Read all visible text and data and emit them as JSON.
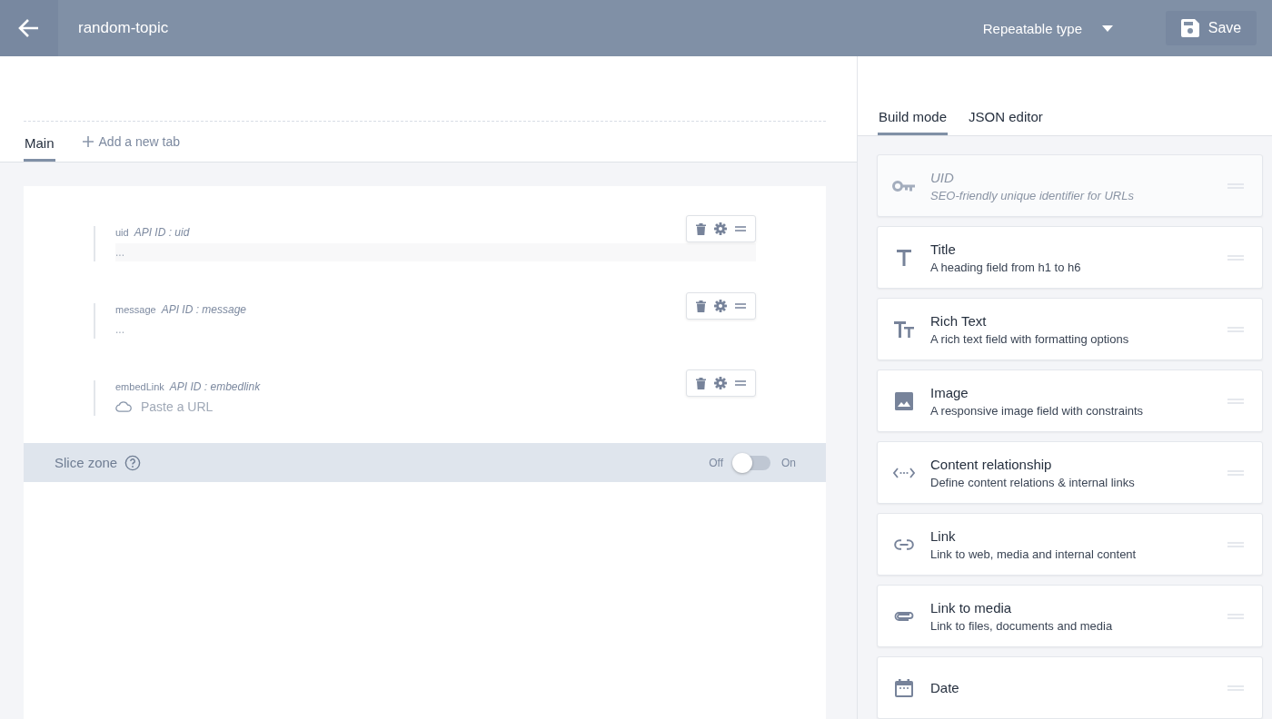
{
  "header": {
    "title": "random-topic",
    "type_select": "Repeatable type",
    "save": "Save"
  },
  "tabs": [
    {
      "label": "Main",
      "selected": true
    }
  ],
  "add_tab": "Add a new tab",
  "fields": [
    {
      "kind": "uid",
      "label": "uid",
      "api_id": "API ID : uid",
      "placeholder": "..."
    },
    {
      "kind": "text",
      "label": "message",
      "api_id": "API ID : message",
      "placeholder": "..."
    },
    {
      "kind": "embed",
      "label": "embedLink",
      "api_id": "API ID : embedlink",
      "placeholder": "Paste a URL"
    }
  ],
  "slice_zone": {
    "label": "Slice zone",
    "off": "Off",
    "on_label": "On",
    "on": false
  },
  "side_tabs": [
    {
      "label": "Build mode",
      "selected": true
    },
    {
      "label": "JSON editor",
      "selected": false
    }
  ],
  "widgets": [
    {
      "kind": "uid",
      "title": "UID",
      "description": "SEO-friendly unique identifier for URLs",
      "disabled": true
    },
    {
      "kind": "title",
      "title": "Title",
      "description": "A heading field from h1 to h6",
      "disabled": false
    },
    {
      "kind": "richtext",
      "title": "Rich Text",
      "description": "A rich text field with formatting options",
      "disabled": false
    },
    {
      "kind": "image",
      "title": "Image",
      "description": "A responsive image field with constraints",
      "disabled": false
    },
    {
      "kind": "relation",
      "title": "Content relationship",
      "description": "Define content relations & internal links",
      "disabled": false
    },
    {
      "kind": "link",
      "title": "Link",
      "description": "Link to web, media and internal content",
      "disabled": false
    },
    {
      "kind": "media",
      "title": "Link to media",
      "description": "Link to files, documents and media",
      "disabled": false
    },
    {
      "kind": "date",
      "title": "Date",
      "disabled": false
    }
  ]
}
